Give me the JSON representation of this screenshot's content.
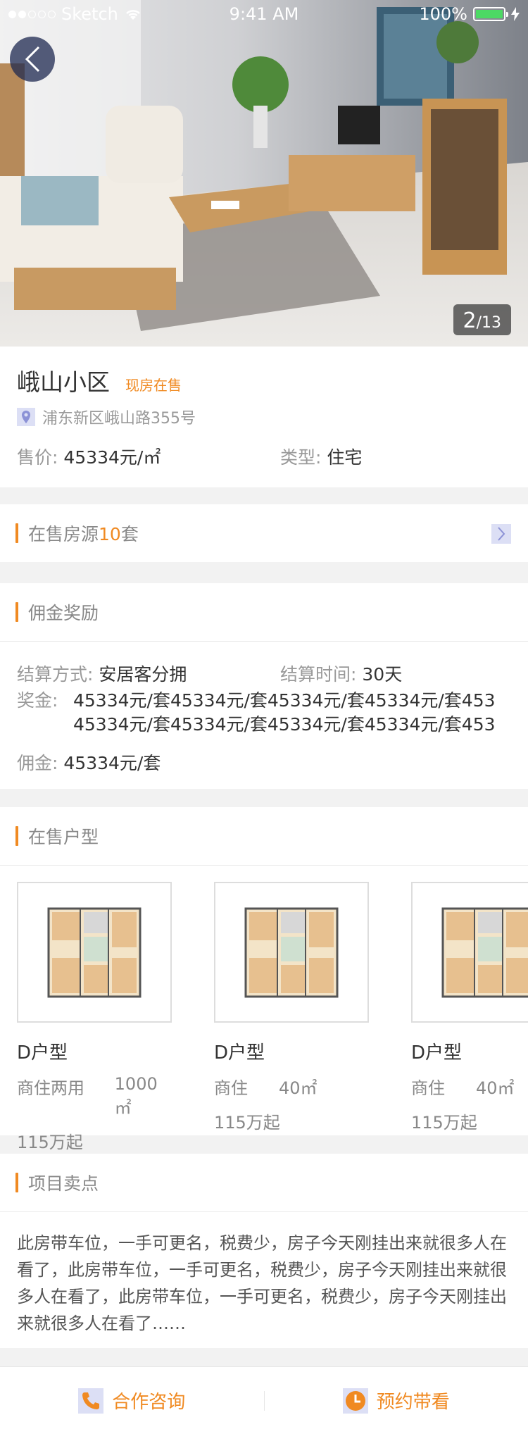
{
  "status_bar": {
    "carrier": "Sketch",
    "time": "9:41 AM",
    "battery": "100%"
  },
  "hero": {
    "counter_current": "2",
    "counter_total": "/13"
  },
  "property": {
    "name": "峨山小区",
    "sale_status": "现房在售",
    "address": "浦东新区峨山路355号",
    "price_label": "售价:",
    "price_value": "45334元/㎡",
    "type_label": "类型:",
    "type_value": "住宅"
  },
  "onsale_listings": {
    "prefix": "在售房源",
    "count": "10",
    "suffix": "套"
  },
  "commission": {
    "title": "佣金奖励",
    "settle_method_label": "结算方式:",
    "settle_method_value": "安居客分拥",
    "settle_time_label": "结算时间:",
    "settle_time_value": "30天",
    "bonus_label": "奖金:",
    "bonus_line1": "45334元/套45334元/套45334元/套45334元/套453",
    "bonus_line2": "45334元/套45334元/套45334元/套45334元/套453",
    "fee_label": "佣金:",
    "fee_value": "45334元/套"
  },
  "units": {
    "title": "在售户型",
    "items": [
      {
        "name": "D户型",
        "usage": "商住两用",
        "area": "1000㎡",
        "price": "115万起"
      },
      {
        "name": "D户型",
        "usage": "商住",
        "area": "40㎡",
        "price": "115万起"
      },
      {
        "name": "D户型",
        "usage": "商住",
        "area": "40㎡",
        "price": "115万起"
      }
    ]
  },
  "selling_points": {
    "title": "项目卖点",
    "text": "此房带车位，一手可更名，税费少，房子今天刚挂出来就很多人在看了，此房带车位，一手可更名，税费少，房子今天刚挂出来就很多人在看了，此房带车位，一手可更名，税费少，房子今天刚挂出来就很多人在看了……"
  },
  "bottom_bar": {
    "consult_label": "合作咨询",
    "appointment_label": "预约带看"
  },
  "colors": {
    "accent": "#f08a22",
    "battery": "#4cd964"
  }
}
